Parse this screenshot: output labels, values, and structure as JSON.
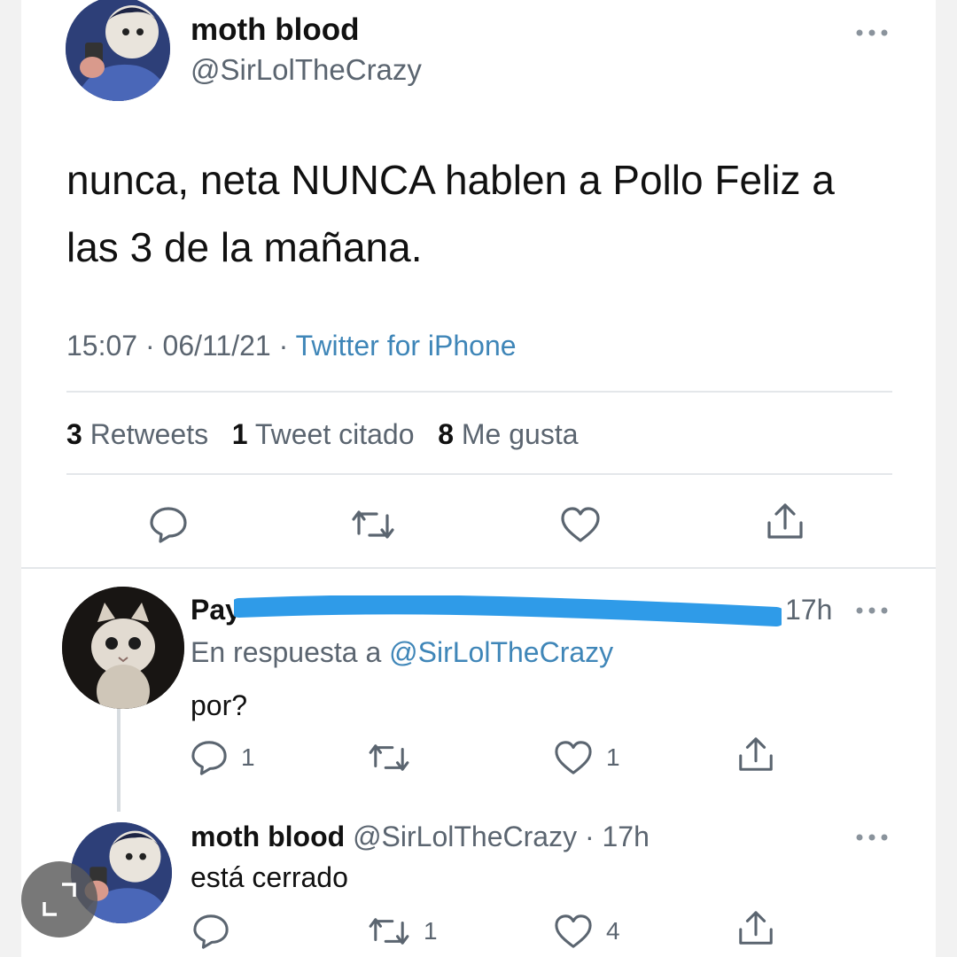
{
  "main_tweet": {
    "name": "moth blood",
    "handle": "@SirLolTheCrazy",
    "text_line1": "nunca, neta NUNCA hablen a Pollo Feliz a",
    "text_line2": "las 3 de la mañana.",
    "time": "15:07",
    "date": "06/11/21",
    "source": "Twitter for iPhone",
    "retweets_count": "3",
    "retweets_label": "Retweets",
    "quotes_count": "1",
    "quotes_label": "Tweet citado",
    "likes_count": "8",
    "likes_label": "Me gusta"
  },
  "reply1": {
    "name": "Pay",
    "time": "17h",
    "reply_prefix": "En respuesta a",
    "reply_to": "@SirLolTheCrazy",
    "text": "por?",
    "reply_count": "1",
    "retweet_count": "",
    "like_count": "1"
  },
  "reply2": {
    "name": "moth blood",
    "handle": "@SirLolTheCrazy",
    "time": "17h",
    "text": "está cerrado",
    "reply_count": "",
    "retweet_count": "1",
    "like_count": "4"
  },
  "icons": {
    "more": "more-horizontal-icon",
    "reply": "reply-icon",
    "retweet": "retweet-icon",
    "like": "heart-icon",
    "share": "share-icon",
    "expand": "expand-icon"
  },
  "colors": {
    "link": "#3f86b8",
    "muted": "#5b6570",
    "scribble": "#2f9be8"
  }
}
